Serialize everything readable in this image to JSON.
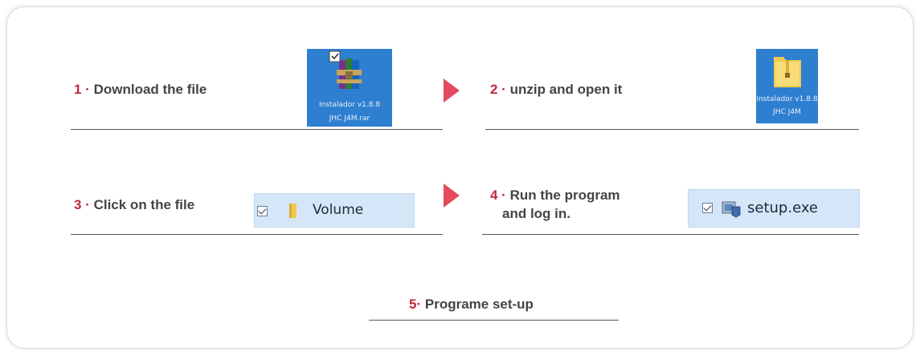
{
  "steps": [
    {
      "number": "1 ·",
      "text": "Download the file"
    },
    {
      "number": "2 ·",
      "text": "unzip and open it"
    },
    {
      "number": "3 ·",
      "text": "Click on the file"
    },
    {
      "number": "4 ·",
      "text": "Run the program",
      "text2": "and log in."
    },
    {
      "number": "5·",
      "text": "Programe set-up"
    }
  ],
  "files": {
    "rar_caption_1": "Instalador v1.8.8",
    "rar_caption_2": "JHC J4M.rar",
    "folder_caption_1": "Instalador v1.8.8",
    "folder_caption_2": "JHC J4M",
    "volume_label": "Volume",
    "setup_label": "setup.exe"
  },
  "colors": {
    "accent": "#c0283e",
    "arrow": "#e44a5e",
    "icon_bg": "#2f7fd1",
    "row_highlight": "#d4e6f7"
  }
}
